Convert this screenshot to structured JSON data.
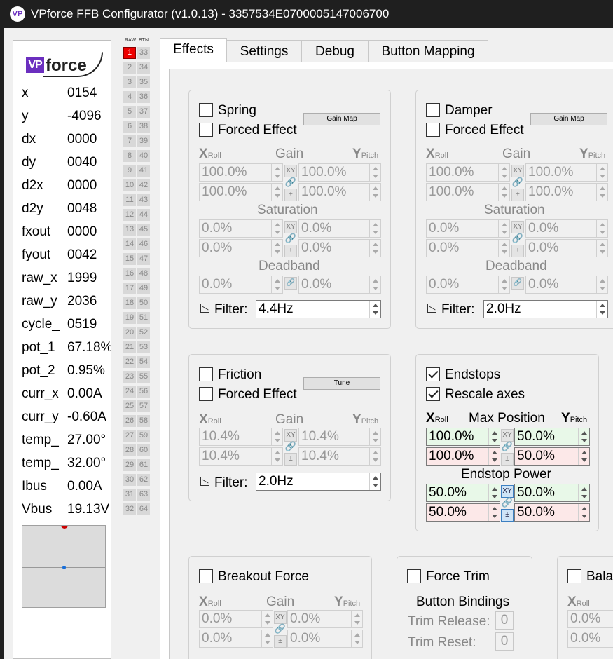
{
  "window": {
    "app_icon_text": "VP",
    "title": "VPforce FFB Configurator (v1.0.13) - 3357534E0700005147006700"
  },
  "logo": {
    "vp": "VP",
    "force": "force"
  },
  "readouts": [
    {
      "label": "x",
      "value": "0154"
    },
    {
      "label": "y",
      "value": "-4096"
    },
    {
      "label": "dx",
      "value": "0000"
    },
    {
      "label": "dy",
      "value": "0040"
    },
    {
      "label": "d2x",
      "value": "0000"
    },
    {
      "label": "d2y",
      "value": "0048"
    },
    {
      "label": "fxout",
      "value": "0000"
    },
    {
      "label": "fyout",
      "value": "0042"
    },
    {
      "label": "raw_x",
      "value": "1999"
    },
    {
      "label": "raw_y",
      "value": "2036"
    },
    {
      "label": "cycle_",
      "value": "0519"
    },
    {
      "label": "pot_1",
      "value": "67.18%"
    },
    {
      "label": "pot_2",
      "value": "0.95%"
    },
    {
      "label": "curr_x",
      "value": "0.00A"
    },
    {
      "label": "curr_y",
      "value": "-0.60A"
    },
    {
      "label": "temp_",
      "value": "27.00°"
    },
    {
      "label": "temp_",
      "value": "32.00°"
    },
    {
      "label": "Ibus",
      "value": "0.00A"
    },
    {
      "label": "Vbus",
      "value": "19.13V"
    }
  ],
  "button_grid": {
    "raw_header": "RAW",
    "btn_header": "BTN",
    "raw": [
      "1",
      "2",
      "3",
      "4",
      "5",
      "6",
      "7",
      "8",
      "9",
      "10",
      "11",
      "12",
      "13",
      "14",
      "15",
      "16",
      "17",
      "18",
      "19",
      "20",
      "21",
      "22",
      "23",
      "24",
      "25",
      "26",
      "27",
      "28",
      "29",
      "30",
      "31",
      "32"
    ],
    "btn": [
      "33",
      "34",
      "35",
      "36",
      "37",
      "38",
      "39",
      "40",
      "41",
      "42",
      "43",
      "44",
      "45",
      "46",
      "47",
      "48",
      "49",
      "50",
      "51",
      "52",
      "53",
      "54",
      "55",
      "56",
      "57",
      "58",
      "59",
      "60",
      "61",
      "62",
      "63",
      "64"
    ],
    "active_raw": "1"
  },
  "tabs": [
    "Effects",
    "Settings",
    "Debug",
    "Button Mapping"
  ],
  "active_tab": "Effects",
  "common": {
    "x_letter": "X",
    "x_sub": "Roll",
    "y_letter": "Y",
    "y_sub": "Pitch",
    "gain": "Gain",
    "saturation": "Saturation",
    "deadband": "Deadband",
    "filter": "Filter:",
    "forced_effect": "Forced Effect",
    "xy": "XY",
    "link": "🔗",
    "pm": "±"
  },
  "spring": {
    "title": "Spring",
    "gain_map": "Gain Map",
    "gain": [
      "100.0%",
      "100.0%",
      "100.0%",
      "100.0%"
    ],
    "saturation": [
      "0.0%",
      "0.0%",
      "0.0%",
      "0.0%"
    ],
    "deadband": [
      "0.0%",
      "0.0%"
    ],
    "filter": "4.4Hz"
  },
  "damper": {
    "title": "Damper",
    "gain_map": "Gain Map",
    "gain": [
      "100.0%",
      "100.0%",
      "100.0%",
      "100.0%"
    ],
    "saturation": [
      "0.0%",
      "0.0%",
      "0.0%",
      "0.0%"
    ],
    "deadband": [
      "0.0%",
      "0.0%"
    ],
    "filter": "2.0Hz"
  },
  "friction": {
    "title": "Friction",
    "tune": "Tune",
    "gain": [
      "10.4%",
      "10.4%",
      "10.4%",
      "10.4%"
    ],
    "filter": "2.0Hz"
  },
  "endstops": {
    "title": "Endstops",
    "rescale": "Rescale axes",
    "max_position": "Max Position",
    "endstop_power": "Endstop Power",
    "max_pos": [
      "100.0%",
      "50.0%",
      "100.0%",
      "50.0%"
    ],
    "power": [
      "50.0%",
      "50.0%",
      "50.0%",
      "50.0%"
    ]
  },
  "breakout": {
    "title": "Breakout Force",
    "gain": [
      "0.0%",
      "0.0%",
      "0.0%",
      "0.0%"
    ]
  },
  "trim": {
    "title": "Force Trim",
    "bindings": "Button Bindings",
    "release": "Trim Release:",
    "release_val": "0",
    "reset": "Trim Reset:",
    "reset_val": "0"
  },
  "balance": {
    "title": "Bala",
    "values": [
      "0.0%",
      "0.0%"
    ]
  }
}
